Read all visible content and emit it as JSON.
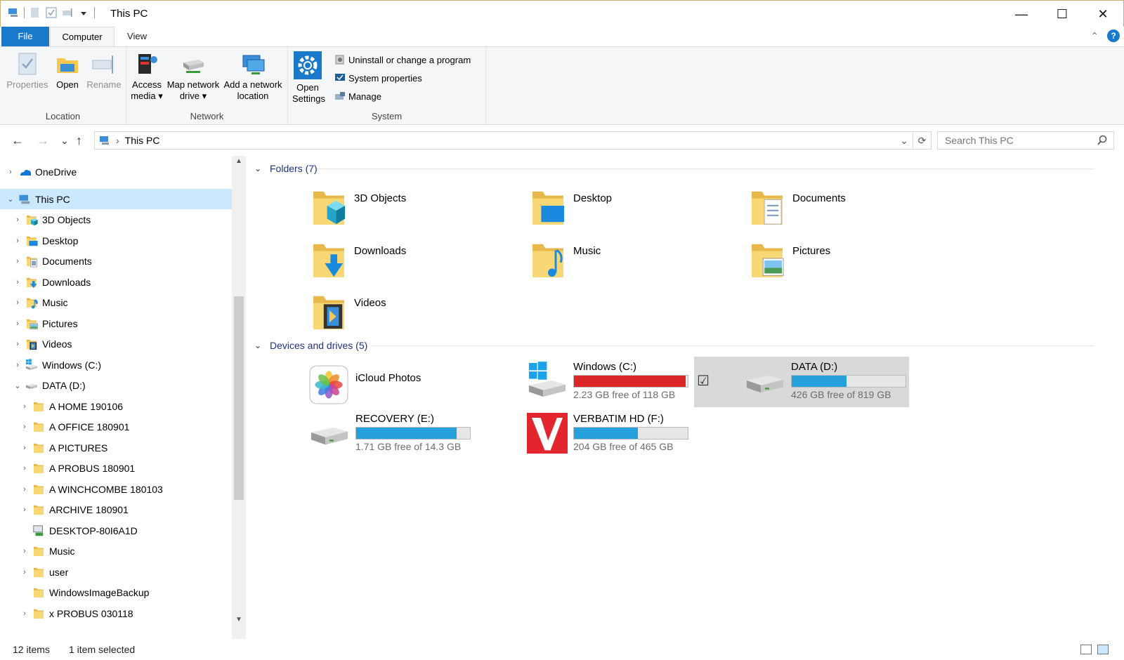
{
  "window": {
    "title": "This PC",
    "minimize_glyph": "—",
    "maximize_glyph": "☐",
    "close_glyph": "✕"
  },
  "ribbon_tabs": {
    "file": "File",
    "computer": "Computer",
    "view": "View"
  },
  "ribbon": {
    "help_glyph": "?",
    "collapse_glyph": "⌃",
    "location": {
      "label": "Location",
      "properties": "Properties",
      "open": "Open",
      "rename": "Rename"
    },
    "network": {
      "label": "Network",
      "access_media_1": "Access",
      "access_media_2": "media ▾",
      "map_drive_1": "Map network",
      "map_drive_2": "drive ▾",
      "add_location_1": "Add a network",
      "add_location_2": "location"
    },
    "system": {
      "label": "System",
      "open_settings_1": "Open",
      "open_settings_2": "Settings",
      "uninstall": "Uninstall or change a program",
      "system_properties": "System properties",
      "manage": "Manage"
    }
  },
  "navigation": {
    "back": "←",
    "forward": "→",
    "recent": "⌄",
    "up": "↑",
    "breadcrumb_separator": "›",
    "breadcrumb": "This PC",
    "address_dropdown": "⌄",
    "refresh": "⟳",
    "search_placeholder": "Search This PC"
  },
  "tree": [
    {
      "label": "OneDrive",
      "chevron": "›",
      "icon": "onedrive-icon"
    },
    {
      "label": "This PC",
      "chevron": "⌄",
      "icon": "this-pc-icon"
    },
    {
      "label": "3D Objects",
      "chevron": "›",
      "icon": "3d-objects-icon"
    },
    {
      "label": "Desktop",
      "chevron": "›",
      "icon": "desktop-folder-icon"
    },
    {
      "label": "Documents",
      "chevron": "›",
      "icon": "documents-folder-icon"
    },
    {
      "label": "Downloads",
      "chevron": "›",
      "icon": "downloads-folder-icon"
    },
    {
      "label": "Music",
      "chevron": "›",
      "icon": "music-folder-icon"
    },
    {
      "label": "Pictures",
      "chevron": "›",
      "icon": "pictures-folder-icon"
    },
    {
      "label": "Videos",
      "chevron": "›",
      "icon": "videos-folder-icon"
    },
    {
      "label": "Windows (C:)",
      "chevron": "›",
      "icon": "windows-drive-icon"
    },
    {
      "label": "DATA (D:)",
      "chevron": "⌄",
      "icon": "drive-icon"
    },
    {
      "label": "A HOME  190106",
      "chevron": "›",
      "icon": "folder-icon"
    },
    {
      "label": "A OFFICE 180901",
      "chevron": "›",
      "icon": "folder-icon"
    },
    {
      "label": "A PICTURES",
      "chevron": "›",
      "icon": "folder-icon"
    },
    {
      "label": "A PROBUS 180901",
      "chevron": "›",
      "icon": "folder-icon"
    },
    {
      "label": "A WINCHCOMBE 180103",
      "chevron": "›",
      "icon": "folder-icon"
    },
    {
      "label": "ARCHIVE 180901",
      "chevron": "›",
      "icon": "folder-icon"
    },
    {
      "label": "DESKTOP-80I6A1D",
      "chevron": "",
      "icon": "network-computer-icon"
    },
    {
      "label": "Music",
      "chevron": "›",
      "icon": "folder-icon"
    },
    {
      "label": "user",
      "chevron": "›",
      "icon": "folder-icon"
    },
    {
      "label": "WindowsImageBackup",
      "chevron": "",
      "icon": "folder-icon"
    },
    {
      "label": "x PROBUS 030118",
      "chevron": "›",
      "icon": "folder-icon"
    }
  ],
  "folders_section": {
    "header": "Folders (7)",
    "chevron": "⌄",
    "items": [
      {
        "name": "3D Objects",
        "icon": "3d-objects-icon"
      },
      {
        "name": "Desktop",
        "icon": "desktop-folder-icon"
      },
      {
        "name": "Documents",
        "icon": "documents-folder-icon"
      },
      {
        "name": "Downloads",
        "icon": "downloads-folder-icon"
      },
      {
        "name": "Music",
        "icon": "music-folder-icon"
      },
      {
        "name": "Pictures",
        "icon": "pictures-folder-icon"
      },
      {
        "name": "Videos",
        "icon": "videos-folder-icon"
      }
    ]
  },
  "drives_section": {
    "header": "Devices and drives (5)",
    "chevron": "⌄",
    "items": [
      {
        "name": "iCloud Photos",
        "icon": "icloud-photos-icon"
      },
      {
        "name": "Windows (C:)",
        "free": "2.23 GB free of 118 GB",
        "used_fraction": 0.98,
        "critical": true,
        "icon": "windows-drive-icon"
      },
      {
        "name": "DATA (D:)",
        "free": "426 GB free of 819 GB",
        "used_fraction": 0.48,
        "selected": true,
        "checkbox": "☑",
        "icon": "drive-icon"
      },
      {
        "name": "RECOVERY (E:)",
        "free": "1.71 GB free of 14.3 GB",
        "used_fraction": 0.88,
        "icon": "drive-icon"
      },
      {
        "name": "VERBATIM HD (F:)",
        "free": "204 GB free of 465 GB",
        "used_fraction": 0.56,
        "icon": "verbatim-drive-icon"
      }
    ]
  },
  "status": {
    "count": "12 items",
    "selection": "1 item selected"
  },
  "colors": {
    "accent": "#1979ca",
    "selection": "#cce8ff",
    "drive_bar": "#26a0da",
    "drive_bar_critical": "#da2626",
    "folder_yellow": "#f8d775",
    "section_header": "#1e3287"
  }
}
